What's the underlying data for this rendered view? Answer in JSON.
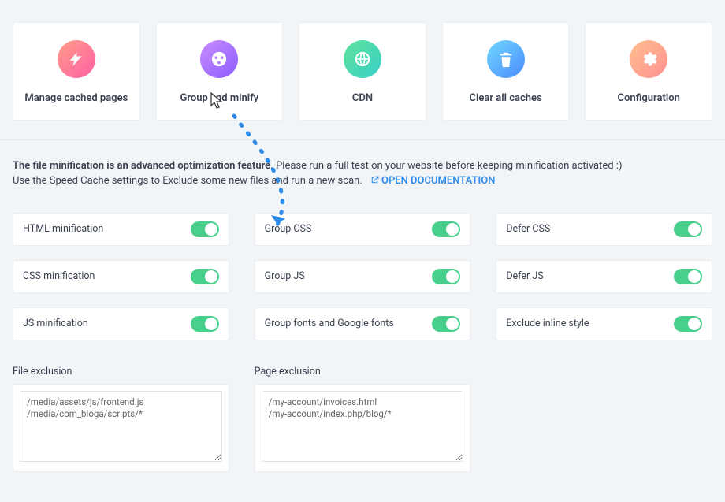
{
  "cards": [
    {
      "label": "Manage cached pages"
    },
    {
      "label": "Group and minify"
    },
    {
      "label": "CDN"
    },
    {
      "label": "Clear all caches"
    },
    {
      "label": "Configuration"
    }
  ],
  "notice": {
    "line1_strong": "The file minification is an advanced optimization feature.",
    "line1_rest": " Please run a full test on your website before keeping minification activated :)",
    "line2": "Use the Speed Cache settings to Exclude some new files and run a new scan.",
    "doc_link": "OPEN DOCUMENTATION"
  },
  "settings": [
    {
      "label": "HTML minification",
      "on": true
    },
    {
      "label": "Group CSS",
      "on": true
    },
    {
      "label": "Defer CSS",
      "on": true
    },
    {
      "label": "CSS minification",
      "on": true
    },
    {
      "label": "Group JS",
      "on": true
    },
    {
      "label": "Defer JS",
      "on": true
    },
    {
      "label": "JS minification",
      "on": true
    },
    {
      "label": "Group fonts and Google fonts",
      "on": true
    },
    {
      "label": "Exclude inline style",
      "on": true
    }
  ],
  "exclusions": {
    "file": {
      "title": "File exclusion",
      "value": "/media/assets/js/frontend.js\n/media/com_bloga/scripts/*"
    },
    "page": {
      "title": "Page exclusion",
      "value": "/my-account/invoices.html\n/my-account/index.php/blog/*"
    }
  }
}
